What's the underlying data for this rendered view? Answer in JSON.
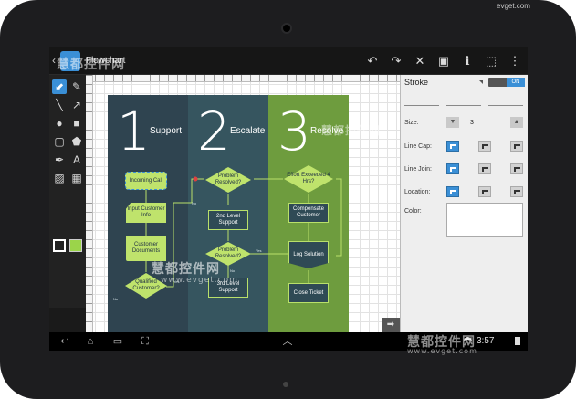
{
  "action_bar": {
    "title": "Flowchart",
    "back": "‹",
    "buttons": [
      {
        "name": "undo-icon",
        "glyph": "↶"
      },
      {
        "name": "redo-icon",
        "glyph": "↷"
      },
      {
        "name": "close-icon",
        "glyph": "✕"
      },
      {
        "name": "save-icon",
        "glyph": "▣"
      },
      {
        "name": "info-icon",
        "glyph": "ℹ"
      },
      {
        "name": "select-icon",
        "glyph": "⬚"
      },
      {
        "name": "more-icon",
        "glyph": "⋮"
      }
    ]
  },
  "toolbox": {
    "tools": [
      {
        "name": "pointer-tool-icon",
        "glyph": "⬋",
        "active": true
      },
      {
        "name": "pencil-tool-icon",
        "glyph": "✎"
      },
      {
        "name": "line-tool-icon",
        "glyph": "╲"
      },
      {
        "name": "connector-tool-icon",
        "glyph": "↗"
      },
      {
        "name": "ellipse-tool-icon",
        "glyph": "●"
      },
      {
        "name": "rectangle-tool-icon",
        "glyph": "■"
      },
      {
        "name": "rounded-rect-tool-icon",
        "glyph": "▢"
      },
      {
        "name": "polygon-tool-icon",
        "glyph": "⬟"
      },
      {
        "name": "pen-tool-icon",
        "glyph": "✒"
      },
      {
        "name": "text-tool-icon",
        "glyph": "A"
      },
      {
        "name": "image-tool-icon",
        "glyph": "▨"
      },
      {
        "name": "table-tool-icon",
        "glyph": "▦"
      }
    ],
    "stroke_color": "#ffffff",
    "fill_color": "#9bd44a"
  },
  "diagram": {
    "lanes": [
      {
        "num": "1",
        "title": "Support",
        "color": "#2f4450"
      },
      {
        "num": "2",
        "title": "Escalate",
        "color": "#36555f"
      },
      {
        "num": "3",
        "title": "Resolve",
        "color": "#6e9c3e"
      }
    ],
    "nodes": {
      "incoming_call": "Incoming Call",
      "input_customer_info": "Input Customer Info",
      "customer_documents": "Customer Documents",
      "qualified_customer": "Qualified Customer?",
      "problem_resolved_1": "Problem Resolved?",
      "second_level_support": "2nd Level Support",
      "problem_resolved_2": "Problem Resolved?",
      "third_level_support": "3rd Level Support",
      "effort_exceeded": "Effort Exceeded 4 Hrs?",
      "compensate_customer": "Compensate Customer",
      "log_solution": "Log Solution",
      "close_ticket": "Close Ticket"
    },
    "edge_labels": {
      "yes": "Yes",
      "no": "No"
    },
    "accent": "#b9e06a"
  },
  "panel": {
    "title": "Stroke",
    "toggle": "ON",
    "size_label": "Size:",
    "size_value": "3",
    "line_cap_label": "Line Cap:",
    "line_join_label": "Line Join:",
    "location_label": "Location:",
    "color_label": "Color:"
  },
  "navbar": {
    "back": "↩",
    "home": "⌂",
    "recents": "▭",
    "screenshot": "⛶",
    "up": "︿",
    "clock": "3:57"
  },
  "watermark": {
    "text": "慧都控件网",
    "url": "www.evget.com",
    "top_right": "evget.com"
  }
}
